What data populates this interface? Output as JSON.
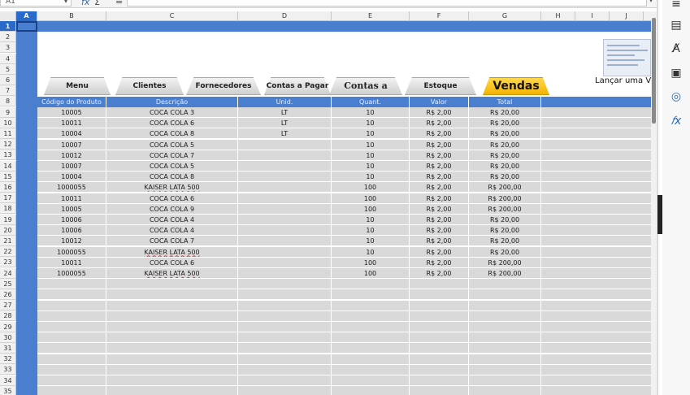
{
  "formula_bar": {
    "name_box": "A1",
    "fx_label": "fx",
    "sigma_label": "Σ",
    "equals_label": "="
  },
  "columns": [
    "A",
    "B",
    "C",
    "D",
    "E",
    "F",
    "G",
    "H",
    "I",
    "J"
  ],
  "rows": [
    "1",
    "2",
    "3",
    "4",
    "5",
    "6",
    "7",
    "8",
    "9",
    "10",
    "11",
    "12",
    "13",
    "14",
    "15",
    "16",
    "17",
    "18",
    "19",
    "20",
    "21",
    "22",
    "23",
    "24",
    "25",
    "26",
    "27",
    "28",
    "29",
    "30",
    "31",
    "32",
    "33",
    "34",
    "35"
  ],
  "tabs": [
    {
      "label": "Menu"
    },
    {
      "label": "Clientes"
    },
    {
      "label": "Fornecedores"
    },
    {
      "label": "Contas a Pagar"
    },
    {
      "label": "Contas a Receber"
    },
    {
      "label": "Estoque"
    },
    {
      "label": "Vendas"
    }
  ],
  "launch_label": "Lançar  uma Ve",
  "table": {
    "headers": [
      "Código do Produto",
      "Descrição",
      "Unid.",
      "Quant.",
      "Valor",
      "Total"
    ],
    "rows": [
      [
        "10005",
        "COCA COLA 3",
        "LT",
        "10",
        "R$ 2,00",
        "R$ 20,00"
      ],
      [
        "10011",
        "COCA COLA 6",
        "LT",
        "10",
        "R$ 2,00",
        "R$ 20,00"
      ],
      [
        "10004",
        "COCA COLA 8",
        "LT",
        "10",
        "R$ 2,00",
        "R$ 20,00"
      ],
      [
        "10007",
        "COCA COLA 5",
        "",
        "10",
        "R$ 2,00",
        "R$ 20,00"
      ],
      [
        "10012",
        "COCA COLA 7",
        "",
        "10",
        "R$ 2,00",
        "R$ 20,00"
      ],
      [
        "10007",
        "COCA COLA 5",
        "",
        "10",
        "R$ 2,00",
        "R$ 20,00"
      ],
      [
        "10004",
        "COCA COLA 8",
        "",
        "10",
        "R$ 2,00",
        "R$ 20,00"
      ],
      [
        "1000055",
        "KAISER LATA 500",
        "",
        "100",
        "R$ 2,00",
        "R$ 200,00"
      ],
      [
        "10011",
        "COCA COLA 6",
        "",
        "100",
        "R$ 2,00",
        "R$ 200,00"
      ],
      [
        "10005",
        "COCA COLA 9",
        "",
        "100",
        "R$ 2,00",
        "R$ 200,00"
      ],
      [
        "10006",
        "COCA COLA 4",
        "",
        "10",
        "R$ 2,00",
        "R$ 20,00"
      ],
      [
        "10006",
        "COCA COLA 4",
        "",
        "10",
        "R$ 2,00",
        "R$ 20,00"
      ],
      [
        "10012",
        "COCA COLA 7",
        "",
        "10",
        "R$ 2,00",
        "R$ 20,00"
      ],
      [
        "1000055",
        "KAISER LATA 500",
        "",
        "10",
        "R$ 2,00",
        "R$ 20,00"
      ],
      [
        "10011",
        "COCA COLA 6",
        "",
        "100",
        "R$ 2,00",
        "R$ 200,00"
      ],
      [
        "1000055",
        "KAISER LATA 500",
        "",
        "100",
        "R$ 2,00",
        "R$ 200,00"
      ],
      [
        "",
        "",
        "",
        "",
        "",
        ""
      ],
      [
        "",
        "",
        "",
        "",
        "",
        ""
      ],
      [
        "",
        "",
        "",
        "",
        "",
        ""
      ],
      [
        "",
        "",
        "",
        "",
        "",
        ""
      ],
      [
        "",
        "",
        "",
        "",
        "",
        ""
      ],
      [
        "",
        "",
        "",
        "",
        "",
        ""
      ],
      [
        "",
        "",
        "",
        "",
        "",
        ""
      ],
      [
        "",
        "",
        "",
        "",
        "",
        ""
      ],
      [
        "",
        "",
        "",
        "",
        "",
        ""
      ],
      [
        "",
        "",
        "",
        "",
        "",
        ""
      ],
      [
        "",
        "",
        "",
        "",
        "",
        ""
      ],
      [
        "",
        "",
        "",
        "",
        "",
        ""
      ]
    ]
  },
  "sidebar": {
    "icons": [
      "menu-icon",
      "properties-icon",
      "styles-icon",
      "gallery-icon",
      "navigator-icon",
      "functions-icon"
    ]
  },
  "colors": {
    "accent_blue": "#4a7fd0",
    "active_tab": "#f3b400",
    "cell_gray": "#d9d9d9"
  }
}
